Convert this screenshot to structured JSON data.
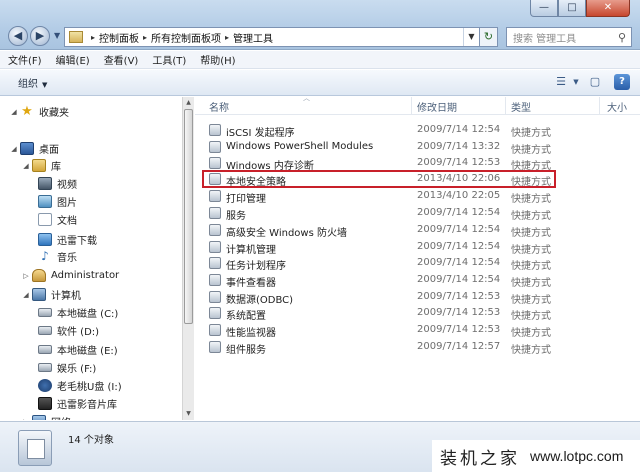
{
  "window": {
    "min": "—",
    "max": "□",
    "close": "✕"
  },
  "address": {
    "crumbs": [
      "控制面板",
      "所有控制面板项",
      "管理工具"
    ],
    "separator": "▸"
  },
  "search": {
    "placeholder": "搜索 管理工具"
  },
  "menu": [
    "文件(F)",
    "编辑(E)",
    "查看(V)",
    "工具(T)",
    "帮助(H)"
  ],
  "toolbar": {
    "organize": "组织"
  },
  "nav": {
    "favorites": "收藏夹",
    "desktop": "桌面",
    "libraries": "库",
    "video": "视频",
    "pictures": "图片",
    "documents": "文档",
    "thunder": "迅雷下载",
    "music": "音乐",
    "user": "Administrator",
    "computer": "计算机",
    "drive_c": "本地磁盘 (C:)",
    "drive_d": "软件 (D:)",
    "drive_e": "本地磁盘 (E:)",
    "drive_f": "娱乐 (F:)",
    "drive_i": "老毛桃U盘 (I:)",
    "thunder_lib": "迅雷影音片库",
    "network": "网络"
  },
  "columns": {
    "name": "名称",
    "date": "修改日期",
    "type": "类型",
    "size": "大小"
  },
  "files": [
    {
      "name": "iSCSI 发起程序",
      "date": "2009/7/14 12:54",
      "type": "快捷方式"
    },
    {
      "name": "Windows PowerShell Modules",
      "date": "2009/7/14 13:32",
      "type": "快捷方式"
    },
    {
      "name": "Windows 内存诊断",
      "date": "2009/7/14 12:53",
      "type": "快捷方式"
    },
    {
      "name": "本地安全策略",
      "date": "2013/4/10 22:06",
      "type": "快捷方式"
    },
    {
      "name": "打印管理",
      "date": "2013/4/10 22:05",
      "type": "快捷方式"
    },
    {
      "name": "服务",
      "date": "2009/7/14 12:54",
      "type": "快捷方式"
    },
    {
      "name": "高级安全 Windows 防火墙",
      "date": "2009/7/14 12:54",
      "type": "快捷方式"
    },
    {
      "name": "计算机管理",
      "date": "2009/7/14 12:54",
      "type": "快捷方式"
    },
    {
      "name": "任务计划程序",
      "date": "2009/7/14 12:54",
      "type": "快捷方式"
    },
    {
      "name": "事件查看器",
      "date": "2009/7/14 12:54",
      "type": "快捷方式"
    },
    {
      "name": "数据源(ODBC)",
      "date": "2009/7/14 12:53",
      "type": "快捷方式"
    },
    {
      "name": "系统配置",
      "date": "2009/7/14 12:53",
      "type": "快捷方式"
    },
    {
      "name": "性能监视器",
      "date": "2009/7/14 12:53",
      "type": "快捷方式"
    },
    {
      "name": "组件服务",
      "date": "2009/7/14 12:57",
      "type": "快捷方式"
    }
  ],
  "highlight_color": "#c8202a",
  "status": {
    "count": "14 个对象"
  },
  "watermark": {
    "cn": "装机之家",
    "url": "www.lotpc.com"
  }
}
